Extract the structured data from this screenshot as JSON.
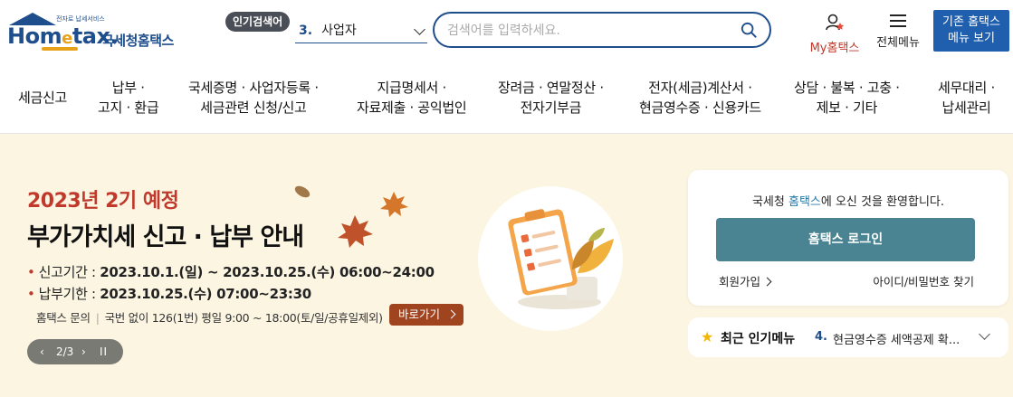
{
  "header": {
    "logo_tagline": "전자로 납세서비스",
    "logo_brand_1": "Hom",
    "logo_brand_e": "e",
    "logo_brand_2": "tax.",
    "logo_korean": "국세청홈택스",
    "popular_badge": "인기검색어",
    "popular_num": "3.",
    "popular_term": "사업자",
    "search_placeholder": "검색어를 입력하세요.",
    "my_hometax": "My홈택스",
    "all_menu": "전체메뉴",
    "old_menu_1": "기존 홈택스",
    "old_menu_2": "메뉴 보기"
  },
  "nav": {
    "items": [
      {
        "l1": "세금신고",
        "l2": ""
      },
      {
        "l1": "납부 ·",
        "l2": "고지 · 환급"
      },
      {
        "l1": "국세증명 · 사업자등록 ·",
        "l2": "세금관련 신청/신고"
      },
      {
        "l1": "지급명세서 ·",
        "l2": "자료제출 · 공익법인"
      },
      {
        "l1": "장려금 · 연말정산 ·",
        "l2": "전자기부금"
      },
      {
        "l1": "전자(세금)계산서 ·",
        "l2": "현금영수증 · 신용카드"
      },
      {
        "l1": "상담 · 불복 · 고충 ·",
        "l2": "제보 · 기타"
      },
      {
        "l1": "세무대리 ·",
        "l2": "납세관리"
      }
    ]
  },
  "hero": {
    "subtitle": "2023년 2기 예정",
    "title": "부가가치세 신고 · 납부 안내",
    "period_label": "신고기간 :",
    "period_value": "2023.10.1.(일) ~ 2023.10.25.(수) 06:00~24:00",
    "deadline_label": "납부기한 :",
    "deadline_value": "2023.10.25.(수) 07:00~23:30",
    "contact_label": "홈택스 문의",
    "contact_value": "국번 없이 126(1번) 평일 9:00 ~ 18:00(토/일/공휴일제외)",
    "goto_button": "바로가기",
    "pager": "2/3",
    "colors": {
      "accent": "#c0392b",
      "button": "#a0441f",
      "background": "#fcf5e2"
    }
  },
  "login": {
    "welcome_pre": "국세청 ",
    "welcome_hl": "홈택스",
    "welcome_post": "에 오신 것을 환영합니다.",
    "login_button": "홈택스 로그인",
    "signup": "회원가입",
    "find_id": "아이디/비밀번호 찾기",
    "colors": {
      "login_button": "#4a8392"
    }
  },
  "recent": {
    "label": "최근 인기메뉴",
    "num": "4.",
    "text": "현금영수증 세액공제 확..."
  }
}
